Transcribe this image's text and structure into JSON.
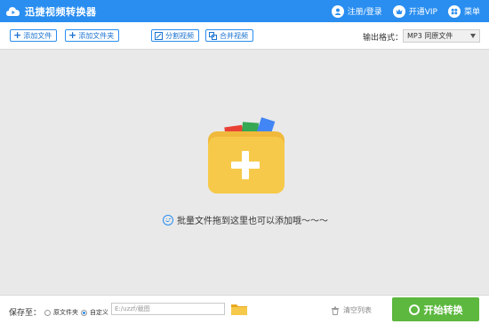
{
  "app": {
    "title": "迅捷视频转换器"
  },
  "titlebar": {
    "login_label": "注册/登录",
    "vip_label": "开通VIP",
    "menu_label": "菜单"
  },
  "toolbar": {
    "add_file_label": "添加文件",
    "add_folder_label": "添加文件夹",
    "split_video_label": "分割视频",
    "merge_video_label": "合并视频",
    "output_format_label": "输出格式：",
    "output_format_value": "MP3  同原文件"
  },
  "drop_area": {
    "hint": "批量文件拖到这里也可以添加哦～～～"
  },
  "bottom": {
    "save_to_label": "保存至：",
    "option_original_folder": "原文件夹",
    "option_custom": "自定义",
    "path_value": "E:/uzzf/截图",
    "clear_list_label": "清空列表",
    "start_label": "开始转换"
  },
  "colors": {
    "titlebar": "#2a8ef0",
    "start_button": "#5cb83e",
    "folder": "#f6c94a"
  }
}
